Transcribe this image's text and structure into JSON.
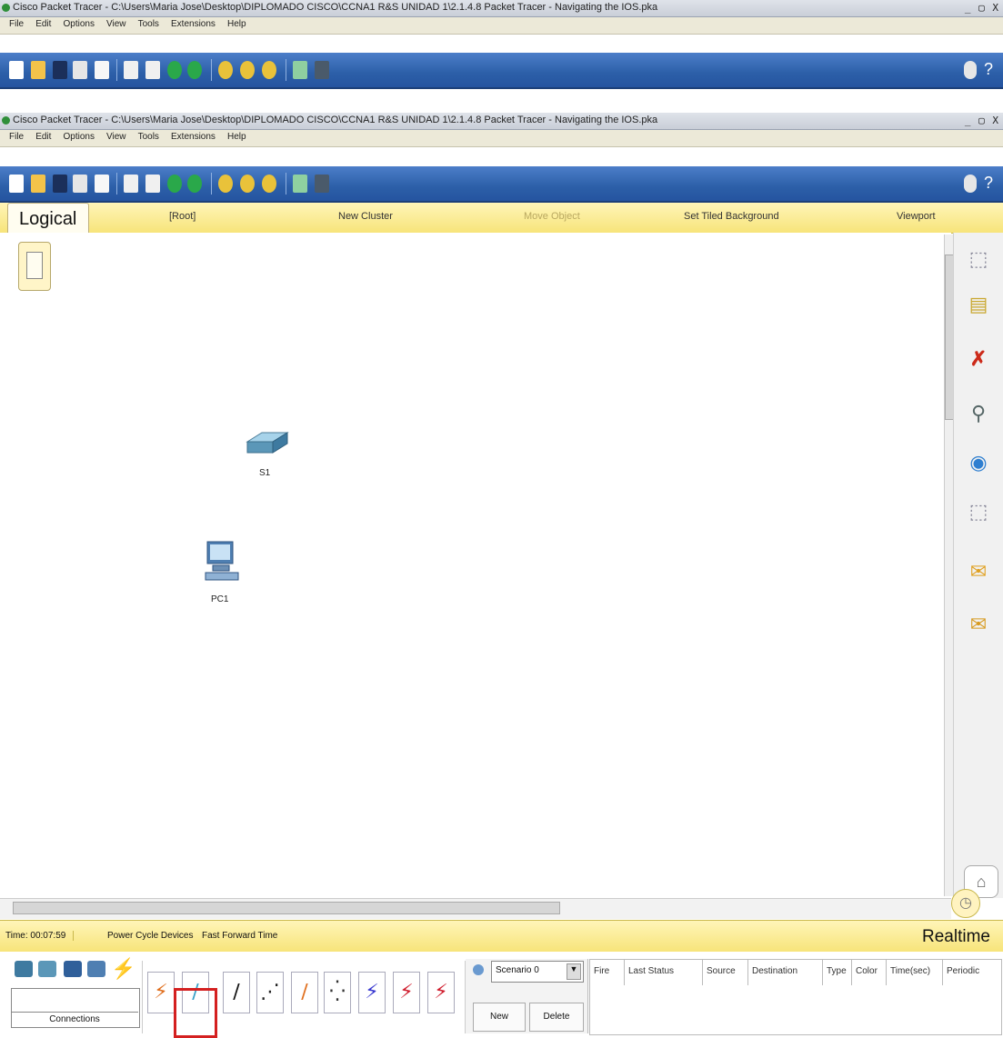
{
  "windows": [
    {
      "title": "Cisco Packet Tracer - C:\\Users\\Maria Jose\\Desktop\\DIPLOMADO CISCO\\CCNA1 R&S UNIDAD 1\\2.1.4.8 Packet Tracer - Navigating the IOS.pka",
      "controls": "_ ▢ X"
    },
    {
      "title": "Cisco Packet Tracer - C:\\Users\\Maria Jose\\Desktop\\DIPLOMADO CISCO\\CCNA1 R&S UNIDAD 1\\2.1.4.8 Packet Tracer - Navigating the IOS.pka",
      "controls": "_ ▢ X"
    }
  ],
  "menu": [
    "File",
    "Edit",
    "Options",
    "View",
    "Tools",
    "Extensions",
    "Help"
  ],
  "workspace_bar": {
    "logical_tab": "Logical",
    "root": "[Root]",
    "new_cluster": "New Cluster",
    "move_object": "Move Object",
    "set_tiled_background": "Set Tiled Background",
    "viewport": "Viewport"
  },
  "devices": {
    "switch_label": "S1",
    "pc_label": "PC1"
  },
  "status": {
    "time": "Time: 00:07:59",
    "power_cycle": "Power Cycle Devices",
    "fast_forward": "Fast Forward Time",
    "mode": "Realtime"
  },
  "bottom": {
    "category_label": "Connections",
    "scenario": "Scenario 0",
    "new_button": "New",
    "delete_button": "Delete",
    "pdu_columns": [
      "Fire",
      "Last Status",
      "Source",
      "Destination",
      "Type",
      "Color",
      "Time(sec)",
      "Periodic"
    ]
  },
  "colors": {
    "toolbar_blue": "#2c5fa8",
    "workspace_yellow": "#f7e47a",
    "selection_red": "#d42020"
  }
}
